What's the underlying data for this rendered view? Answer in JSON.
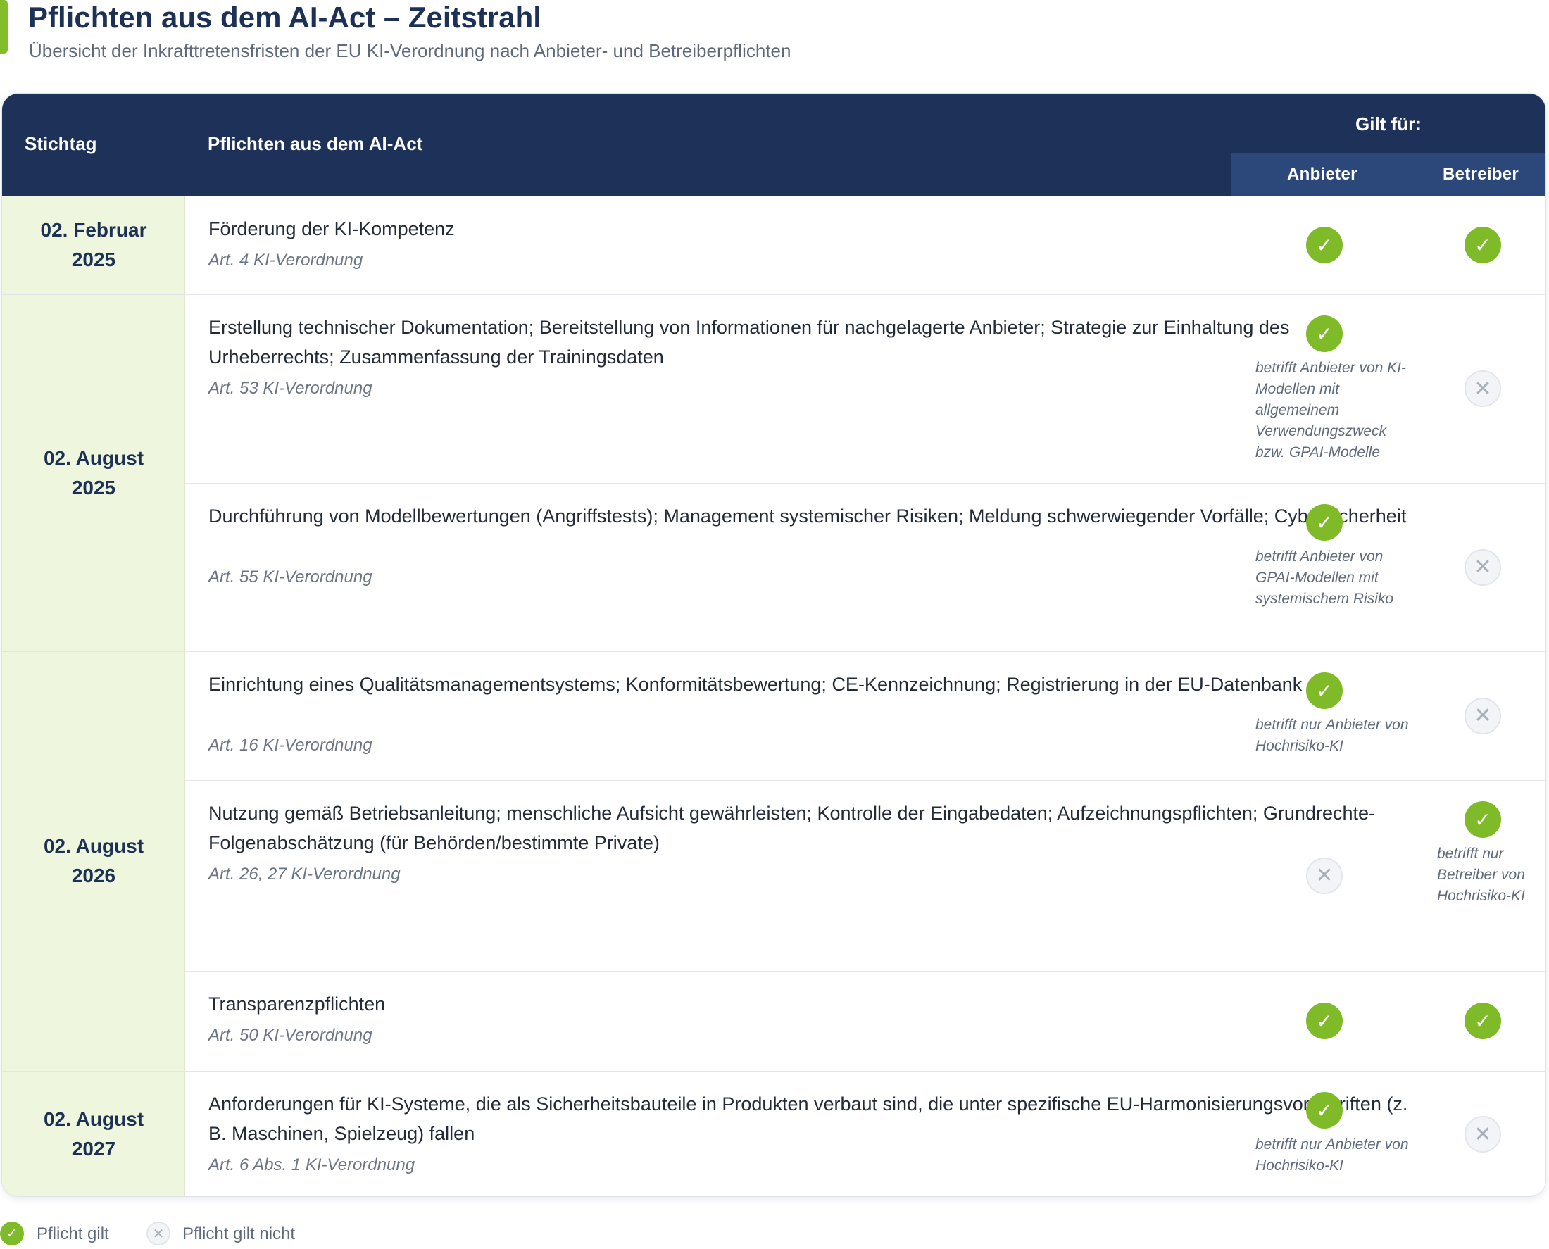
{
  "header": {
    "title": "Pflichten aus dem AI-Act – Zeitstrahl",
    "subtitle": "Übersicht der Inkrafttretensfristen der EU KI-Verordnung nach Anbieter- und Betreiberpflichten"
  },
  "table": {
    "col_stichtag": "Stichtag",
    "col_pflichten": "Pflichten aus dem AI-Act",
    "col_gilt_fuer": "Gilt für:",
    "col_anbieter": "Anbieter",
    "col_betreiber": "Betreiber",
    "groups": [
      {
        "date_line1": "02. Februar",
        "date_line2": "2025"
      },
      {
        "date_line1": "02. August",
        "date_line2": "2025"
      },
      {
        "date_line1": "02. August",
        "date_line2": "2026"
      },
      {
        "date_line1": "02. August",
        "date_line2": "2027"
      }
    ],
    "rows": [
      {
        "text": "Förderung der KI-Kompetenz",
        "ref": "Art. 4 KI-Verordnung",
        "anbieter": true,
        "anbieter_note": "",
        "betreiber": true,
        "betreiber_note": ""
      },
      {
        "text": "Erstellung technischer Dokumentation; Bereitstellung von Informationen für nachgelagerte Anbieter; Strategie zur Einhaltung des Urheberrechts; Zusammenfassung der Trainingsdaten",
        "ref": "Art. 53 KI-Verordnung",
        "anbieter": true,
        "anbieter_note": "betrifft Anbieter von KI-Modellen mit allgemeinem Verwendungszweck bzw. GPAI-Modelle",
        "betreiber": false,
        "betreiber_note": ""
      },
      {
        "text": "Durchführung von Modellbewertungen (Angriffstests); Management systemischer Risiken; Meldung schwerwiegender Vorfälle; Cybersicherheit",
        "ref": "Art. 55 KI-Verordnung",
        "anbieter": true,
        "anbieter_note": "betrifft Anbieter von GPAI-Modellen mit systemischem Risiko",
        "betreiber": false,
        "betreiber_note": ""
      },
      {
        "text": "Einrichtung eines Qualitätsmanagementsystems; Konformitätsbewertung; CE-Kennzeichnung; Registrierung in der EU-Datenbank",
        "ref": "Art. 16 KI-Verordnung",
        "anbieter": true,
        "anbieter_note": "betrifft nur Anbieter von Hochrisiko-KI",
        "betreiber": false,
        "betreiber_note": ""
      },
      {
        "text": "Nutzung gemäß Betriebsanleitung; menschliche Aufsicht gewährleisten; Kontrolle der Eingabedaten; Aufzeichnungspflichten; Grundrechte-Folgenabschätzung (für Behörden/bestimmte Private)",
        "ref": "Art. 26, 27 KI-Verordnung",
        "anbieter": false,
        "anbieter_note": "",
        "betreiber": true,
        "betreiber_note": "betrifft nur Betreiber von Hochrisiko-KI"
      },
      {
        "text": "Transparenzpflichten",
        "ref": "Art. 50 KI-Verordnung",
        "anbieter": true,
        "anbieter_note": "",
        "betreiber": true,
        "betreiber_note": ""
      },
      {
        "text": "Anforderungen für KI-Systeme, die als Sicherheitsbauteile in Produkten verbaut sind, die unter spezifische EU-Harmonisierungsvorschriften (z. B. Maschinen, Spielzeug) fallen",
        "ref": "Art. 6 Abs. 1 KI-Verordnung",
        "anbieter": true,
        "anbieter_note": "betrifft nur Anbieter von Hochrisiko-KI",
        "betreiber": false,
        "betreiber_note": ""
      }
    ]
  },
  "icons": {
    "applies": "check-icon",
    "not_applies": "cross-icon"
  },
  "colors": {
    "navy": "#1e3158",
    "green": "#7fbb28",
    "date_bg": "#eef6dd"
  },
  "legend": {
    "applies_label": "Pflicht gilt",
    "not_applies_label": "Pflicht gilt nicht"
  }
}
